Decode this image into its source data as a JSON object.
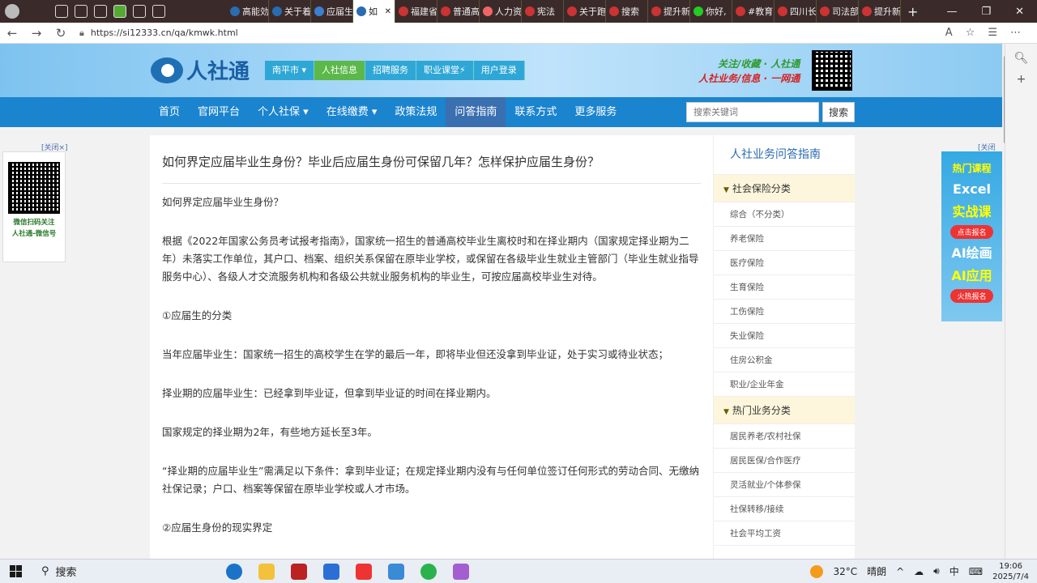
{
  "browser": {
    "profile_label": "",
    "tabs": [
      {
        "label": "高能効",
        "color": "#2a6cb0"
      },
      {
        "label": "关于着",
        "color": "#2a6cb0"
      },
      {
        "label": "应届生",
        "color": "#3a7fd0"
      },
      {
        "label": "如",
        "color": "#2a6cb0",
        "active": true
      },
      {
        "label": "福建省",
        "color": "#c33"
      },
      {
        "label": "普通高",
        "color": "#c33"
      },
      {
        "label": "人力资",
        "color": "#e66"
      },
      {
        "label": "宪法",
        "color": "#c33"
      },
      {
        "label": "关于跑",
        "color": "#c33"
      },
      {
        "label": "搜索",
        "color": "#c33"
      },
      {
        "label": "提升新",
        "color": "#c33"
      },
      {
        "label": "你好,",
        "color": "#2c2"
      },
      {
        "label": "#教育",
        "color": "#c33"
      },
      {
        "label": "四川长",
        "color": "#c33"
      },
      {
        "label": "司法部",
        "color": "#c33"
      },
      {
        "label": "提升新",
        "color": "#c33"
      }
    ],
    "new_tab": "+",
    "url": "https://si12333.cn/qa/kmwk.html"
  },
  "site": {
    "logo_text": "人社通",
    "header_nav": [
      "南平市 ▾",
      "人社信息",
      "招聘服务",
      "职业课堂⚡",
      "用户登录"
    ],
    "slogan_line1": "关注/收藏 · 人社通",
    "slogan_line2": "人社业务/信息 · 一网通",
    "main_nav": [
      "首页",
      "官网平台",
      "个人社保 ▾",
      "在线缴费 ▾",
      "政策法规",
      "问答指南",
      "联系方式",
      "更多服务"
    ],
    "search_placeholder": "搜索关键词",
    "search_button": "搜索"
  },
  "left_ad": {
    "close": "[关闭×]",
    "line1": "微信扫码关注",
    "line2": "人社通-微信号"
  },
  "right_ad": {
    "close": "[关闭×]",
    "hot": "热门课程",
    "excel1": "Excel",
    "excel2": "实战课",
    "btn1": "点击报名",
    "ai1": "AI绘画",
    "ai2": "AI应用",
    "btn2": "火热报名"
  },
  "article": {
    "title": "如何界定应届毕业生身份？毕业后应届生身份可保留几年？怎样保护应届生身份？",
    "paragraphs": [
      "如何界定应届毕业生身份？",
      "根据《2022年国家公务员考试报考指南》，国家统一招生的普通高校毕业生离校时和在择业期内（国家规定择业期为二年）未落实工作单位，其户口、档案、组织关系保留在原毕业学校，或保留在各级毕业生就业主管部门（毕业生就业指导服务中心）、各级人才交流服务机构和各级公共就业服务机构的毕业生，可按应届高校毕业生对待。",
      "①应届生的分类",
      "当年应届毕业生：国家统一招生的高校学生在学的最后一年，即将毕业但还没拿到毕业证，处于实习或待业状态；",
      "择业期的应届毕业生：已经拿到毕业证，但拿到毕业证的时间在择业期内。",
      "国家规定的择业期为2年，有些地方延长至3年。",
      "“择业期的应届毕业生”需满足以下条件：拿到毕业证；在规定择业期内没有与任何单位签订任何形式的劳动合同、无缴纳社保记录；户口、档案等保留在原毕业学校或人才市场。",
      "②应届生身份的现实界定"
    ]
  },
  "sidebar": {
    "title": "人社业务问答指南",
    "cat1": "社会保险分类",
    "cat1_items": [
      "综合（不分类）",
      "养老保险",
      "医疗保险",
      "生育保险",
      "工伤保险",
      "失业保险",
      "住房公积金",
      "职业/企业年金"
    ],
    "cat2": "热门业务分类",
    "cat2_items": [
      "居民养老/农村社保",
      "居民医保/合作医疗",
      "灵活就业/个体参保",
      "社保转移/接续",
      "社会平均工资"
    ]
  },
  "taskbar": {
    "search": "搜索",
    "temperature": "32°C",
    "weather": "晴朗",
    "ime": "中",
    "time": "19:06",
    "date": "2025/7/4"
  }
}
